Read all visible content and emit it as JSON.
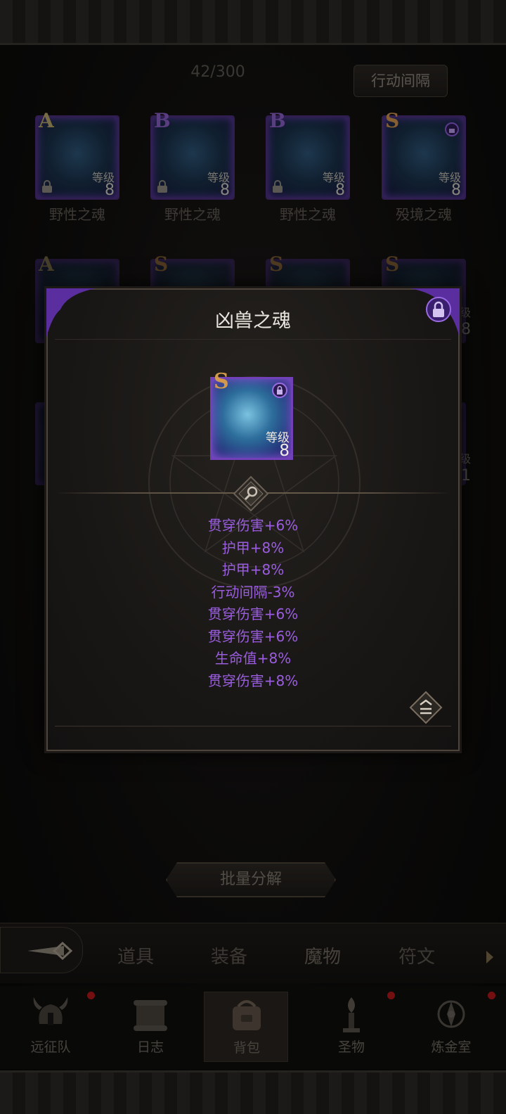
{
  "header": {
    "count": "42/300",
    "sort_button": "行动间隔"
  },
  "grid": {
    "row1": [
      {
        "grade": "A",
        "name": "野性之魂",
        "level_label": "等级",
        "level": "8"
      },
      {
        "grade": "B",
        "name": "野性之魂",
        "level_label": "等级",
        "level": "8"
      },
      {
        "grade": "B",
        "name": "野性之魂",
        "level_label": "等级",
        "level": "8"
      },
      {
        "grade": "S",
        "name": "殁境之魂",
        "level_label": "等级",
        "level": "8"
      }
    ],
    "row2_grades": [
      "A",
      "S",
      "S",
      "S"
    ],
    "partial": {
      "label": "级",
      "level_a": "8",
      "level_b": "1"
    }
  },
  "dialog": {
    "title": "凶兽之魂",
    "item": {
      "grade": "S",
      "level_label": "等级",
      "level": "8"
    },
    "stats": [
      "贯穿伤害+6%",
      "护甲+8%",
      "护甲+8%",
      "行动间隔-3%",
      "贯穿伤害+6%",
      "贯穿伤害+6%",
      "生命值+8%",
      "贯穿伤害+8%"
    ],
    "stat_color": "#9a5de0"
  },
  "decompose_button": "批量分解",
  "tabs": [
    "道具",
    "装备",
    "魔物",
    "符文"
  ],
  "active_tab": "魔物",
  "nav": [
    {
      "label": "远征队",
      "icon": "helmet-icon"
    },
    {
      "label": "日志",
      "icon": "scroll-icon"
    },
    {
      "label": "背包",
      "icon": "backpack-icon"
    },
    {
      "label": "圣物",
      "icon": "torch-icon"
    },
    {
      "label": "炼金室",
      "icon": "alchemy-icon"
    }
  ],
  "active_nav": "背包",
  "colors": {
    "notification": "#b3171b",
    "frame_purple": "#7240b8"
  }
}
